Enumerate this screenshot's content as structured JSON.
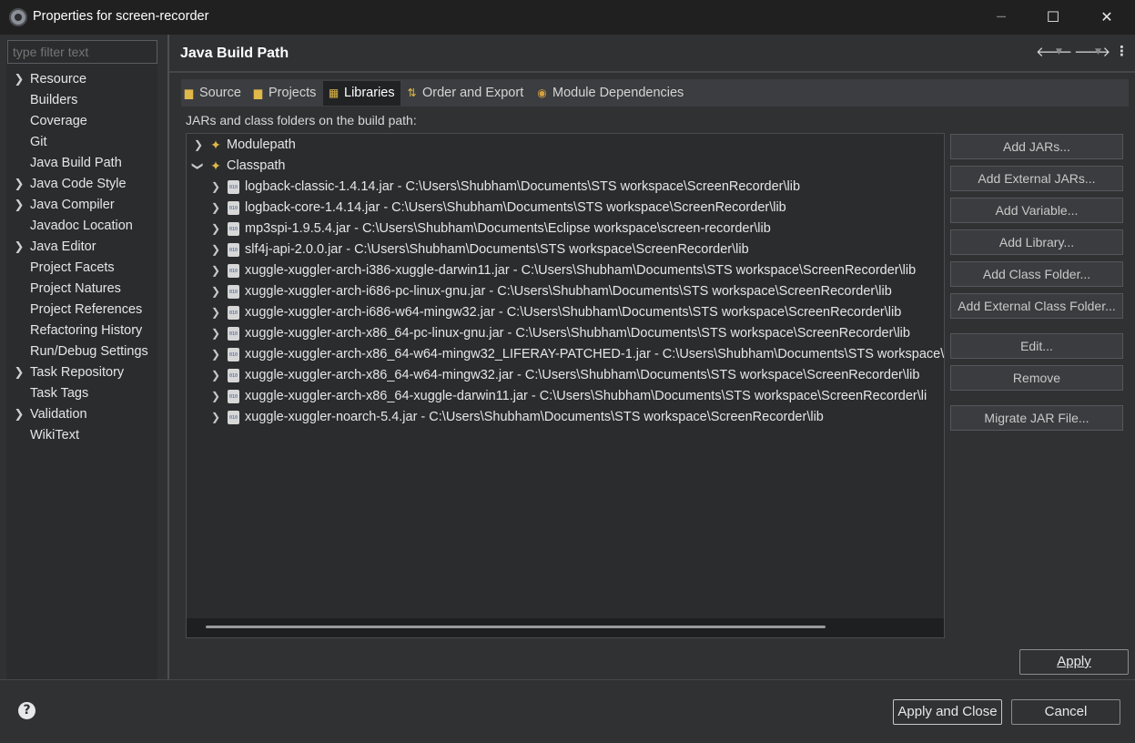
{
  "window": {
    "title": "Properties for screen-recorder",
    "minimize": "─",
    "maximize": "☐",
    "close": "✕"
  },
  "filter": {
    "placeholder": "type filter text"
  },
  "nav": [
    {
      "label": "Resource",
      "expandable": true
    },
    {
      "label": "Builders",
      "expandable": false
    },
    {
      "label": "Coverage",
      "expandable": false
    },
    {
      "label": "Git",
      "expandable": false
    },
    {
      "label": "Java Build Path",
      "expandable": false
    },
    {
      "label": "Java Code Style",
      "expandable": true
    },
    {
      "label": "Java Compiler",
      "expandable": true
    },
    {
      "label": "Javadoc Location",
      "expandable": false
    },
    {
      "label": "Java Editor",
      "expandable": true
    },
    {
      "label": "Project Facets",
      "expandable": false
    },
    {
      "label": "Project Natures",
      "expandable": false
    },
    {
      "label": "Project References",
      "expandable": false
    },
    {
      "label": "Refactoring History",
      "expandable": false
    },
    {
      "label": "Run/Debug Settings",
      "expandable": false
    },
    {
      "label": "Task Repository",
      "expandable": true
    },
    {
      "label": "Task Tags",
      "expandable": false
    },
    {
      "label": "Validation",
      "expandable": true
    },
    {
      "label": "WikiText",
      "expandable": false
    }
  ],
  "header": {
    "title": "Java Build Path",
    "back_icon": "arrow-left-icon",
    "forward_icon": "arrow-right-icon",
    "menu_icon": "more-vert-icon"
  },
  "tabs": [
    {
      "label": "Source",
      "icon": "source-folder-icon"
    },
    {
      "label": "Projects",
      "icon": "projects-icon"
    },
    {
      "label": "Libraries",
      "icon": "libraries-icon",
      "active": true
    },
    {
      "label": "Order and Export",
      "icon": "order-export-icon"
    },
    {
      "label": "Module Dependencies",
      "icon": "module-icon"
    }
  ],
  "build_path_label": "JARs and class folders on the build path:",
  "tree": {
    "modulepath": "Modulepath",
    "classpath": "Classpath",
    "jars": [
      "logback-classic-1.4.14.jar - C:\\Users\\Shubham\\Documents\\STS workspace\\ScreenRecorder\\lib",
      "logback-core-1.4.14.jar - C:\\Users\\Shubham\\Documents\\STS workspace\\ScreenRecorder\\lib",
      "mp3spi-1.9.5.4.jar - C:\\Users\\Shubham\\Documents\\Eclipse workspace\\screen-recorder\\lib",
      "slf4j-api-2.0.0.jar - C:\\Users\\Shubham\\Documents\\STS workspace\\ScreenRecorder\\lib",
      "xuggle-xuggler-arch-i386-xuggle-darwin11.jar - C:\\Users\\Shubham\\Documents\\STS workspace\\ScreenRecorder\\lib",
      "xuggle-xuggler-arch-i686-pc-linux-gnu.jar - C:\\Users\\Shubham\\Documents\\STS workspace\\ScreenRecorder\\lib",
      "xuggle-xuggler-arch-i686-w64-mingw32.jar - C:\\Users\\Shubham\\Documents\\STS workspace\\ScreenRecorder\\lib",
      "xuggle-xuggler-arch-x86_64-pc-linux-gnu.jar - C:\\Users\\Shubham\\Documents\\STS workspace\\ScreenRecorder\\lib",
      "xuggle-xuggler-arch-x86_64-w64-mingw32_LIFERAY-PATCHED-1.jar - C:\\Users\\Shubham\\Documents\\STS workspace\\",
      "xuggle-xuggler-arch-x86_64-w64-mingw32.jar - C:\\Users\\Shubham\\Documents\\STS workspace\\ScreenRecorder\\lib",
      "xuggle-xuggler-arch-x86_64-xuggle-darwin11.jar - C:\\Users\\Shubham\\Documents\\STS workspace\\ScreenRecorder\\li",
      "xuggle-xuggler-noarch-5.4.jar - C:\\Users\\Shubham\\Documents\\STS workspace\\ScreenRecorder\\lib"
    ]
  },
  "side_buttons": {
    "add_jars": "Add JARs...",
    "add_external_jars": "Add External JARs...",
    "add_variable": "Add Variable...",
    "add_library": "Add Library...",
    "add_class_folder": "Add Class Folder...",
    "add_external_class_folder": "Add External Class Folder...",
    "edit": "Edit...",
    "remove": "Remove",
    "migrate_jar": "Migrate JAR File..."
  },
  "buttons": {
    "apply": "Apply",
    "apply_and_close": "Apply and Close",
    "cancel": "Cancel",
    "help": "?"
  }
}
